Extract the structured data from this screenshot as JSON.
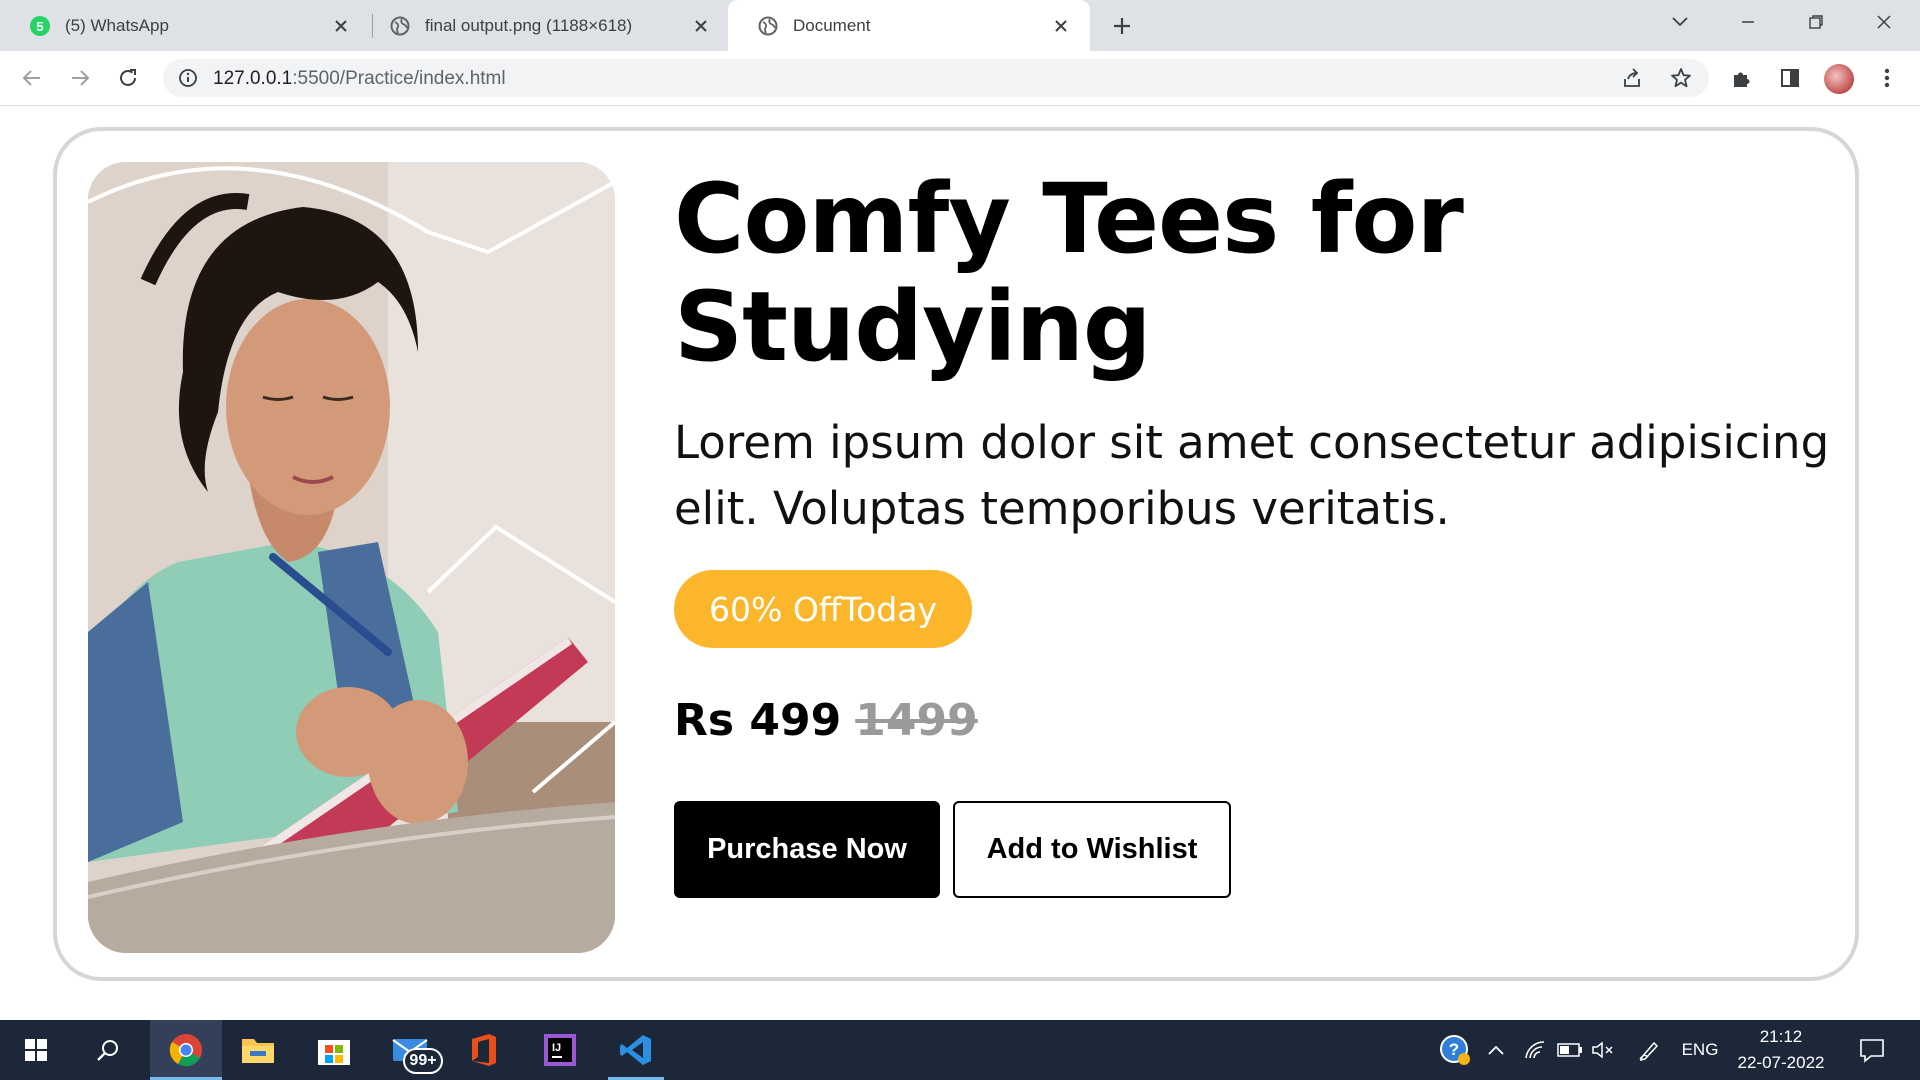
{
  "browser": {
    "tabs": [
      {
        "title": "(5) WhatsApp",
        "favicon": "whatsapp-icon",
        "badge": "5"
      },
      {
        "title": "final output.png (1188×618)",
        "favicon": "globe-icon"
      },
      {
        "title": "Document",
        "favicon": "globe-icon",
        "active": true
      }
    ],
    "url_host": "127.0.0.1",
    "url_rest": ":5500/Practice/index.html"
  },
  "page": {
    "heading": "Comfy Tees for Studying",
    "description": "Lorem ipsum dolor sit amet consectetur adipisicing elit. Voluptas temporibus veritatis.",
    "badge": "60% OffToday",
    "price_current": "Rs 499",
    "price_original": "1499",
    "primary_button": "Purchase Now",
    "secondary_button": "Add to Wishlist",
    "colors": {
      "badge": "#fbb62b",
      "card_border": "#d6d6d6",
      "primary_button": "#000000"
    }
  },
  "taskbar": {
    "mail_badge": "99+",
    "language": "ENG",
    "time": "21:12",
    "date": "22-07-2022"
  }
}
